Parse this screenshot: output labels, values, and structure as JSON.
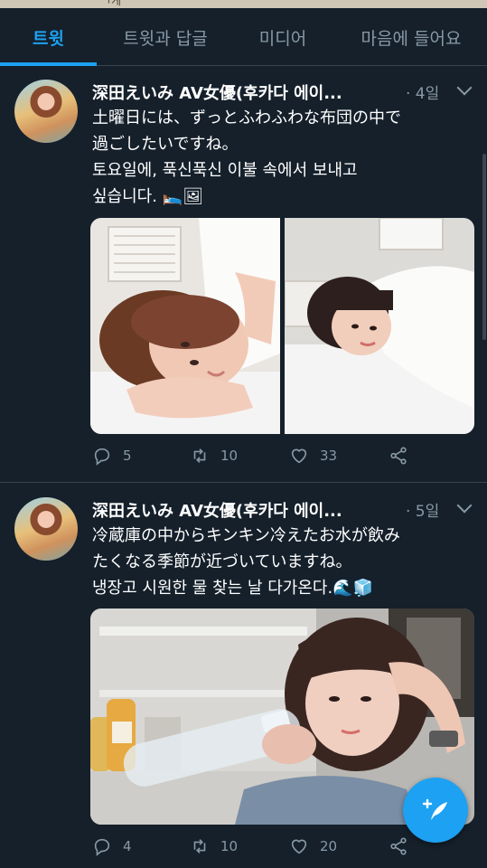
{
  "status_text": "ㄱ게",
  "tabs": [
    {
      "label": "트윗"
    },
    {
      "label": "트윗과 답글"
    },
    {
      "label": "미디어"
    },
    {
      "label": "마음에 들어요"
    }
  ],
  "tweets": [
    {
      "author": "深田えいみ AV女優(후카다 에이...",
      "time": "· 4일",
      "text_lines": [
        "土曜日には、ずっとふわふわな布団の中で",
        "過ごしたいですね。",
        "토요일에, 푹신푹신 이불 속에서 보내고",
        "싶습니다. 🛌🖼"
      ],
      "replies": "5",
      "retweets": "10",
      "likes": "33"
    },
    {
      "author": "深田えいみ AV女優(후카다 에이...",
      "time": "· 5일",
      "text_lines": [
        "冷蔵庫の中からキンキン冷えたお水が飲み",
        "たくなる季節が近づいていますね。",
        "냉장고 시원한 물 찾는 날 다가온다.🌊🧊"
      ],
      "replies": "4",
      "retweets": "10",
      "likes": "20"
    }
  ],
  "colors": {
    "background": "#15202b",
    "accent": "#1da1f2",
    "muted": "#8899a6",
    "divider": "#38444d"
  },
  "icons": [
    "reply-icon",
    "retweet-icon",
    "like-icon",
    "share-icon",
    "chevron-down-icon",
    "compose-tweet-icon"
  ]
}
